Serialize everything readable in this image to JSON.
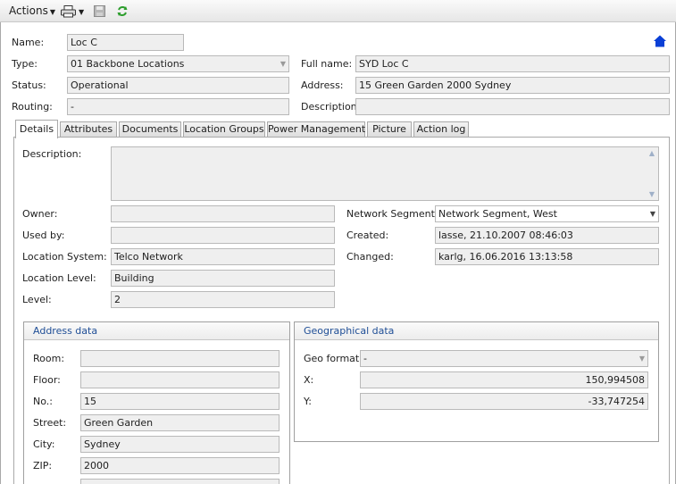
{
  "toolbar": {
    "actions_label": "Actions",
    "print_icon": "printer-icon",
    "save_icon": "floppy-disk-icon",
    "refresh_icon": "refresh-icon"
  },
  "header": {
    "name_label": "Name:",
    "name_value": "Loc C",
    "type_label": "Type:",
    "type_value": "01 Backbone Locations",
    "status_label": "Status:",
    "status_value": "Operational",
    "routing_label": "Routing:",
    "routing_value": "-",
    "fullname_label": "Full name:",
    "fullname_value": "SYD Loc C",
    "address_label": "Address:",
    "address_value": "15 Green Garden 2000 Sydney",
    "description_label": "Description:",
    "description_value": "",
    "home_icon": "home-icon"
  },
  "tabs": [
    {
      "label": "Details"
    },
    {
      "label": "Attributes"
    },
    {
      "label": "Documents"
    },
    {
      "label": "Location Groups"
    },
    {
      "label": "Power Management"
    },
    {
      "label": "Picture"
    },
    {
      "label": "Action log"
    }
  ],
  "details": {
    "description_label": "Description:",
    "description_value": "",
    "owner_label": "Owner:",
    "owner_value": "",
    "usedby_label": "Used by:",
    "usedby_value": "",
    "locsystem_label": "Location System:",
    "locsystem_value": "Telco Network",
    "loclevel_label": "Location Level:",
    "loclevel_value": "Building",
    "level_label": "Level:",
    "level_value": "2",
    "netseg_label": "Network Segments:",
    "netseg_value": "Network Segment, West",
    "created_label": "Created:",
    "created_value": "lasse, 21.10.2007 08:46:03",
    "changed_label": "Changed:",
    "changed_value": "karlg, 16.06.2016 13:13:58"
  },
  "address_data": {
    "title": "Address data",
    "room_label": "Room:",
    "room_value": "",
    "floor_label": "Floor:",
    "floor_value": "",
    "no_label": "No.:",
    "no_value": "15",
    "street_label": "Street:",
    "street_value": "Green Garden",
    "city_label": "City:",
    "city_value": "Sydney",
    "zip_label": "ZIP:",
    "zip_value": "2000"
  },
  "geo_data": {
    "title": "Geographical data",
    "format_label": "Geo format:",
    "format_value": "-",
    "x_label": "X:",
    "x_value": "150,994508",
    "y_label": "Y:",
    "y_value": "-33,747254"
  },
  "colors": {
    "group_title": "#1f4e96",
    "home_icon": "#0a3fd6",
    "refresh_icon": "#2e9e2e",
    "field_bg": "#efefef"
  }
}
